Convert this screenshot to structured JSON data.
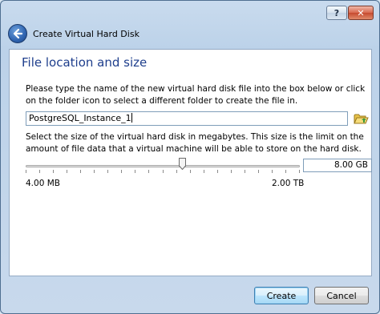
{
  "window": {
    "header_title": "Create Virtual Hard Disk"
  },
  "titlebar": {
    "help_label": "?",
    "close_label": "✕"
  },
  "page": {
    "title": "File location and size",
    "location_instruction": "Please type the name of the new virtual hard disk file into the box below or click on the folder icon to select a different folder to create the file in.",
    "file_name_value": "PostgreSQL_Instance_1",
    "size_instruction": "Select the size of the virtual hard disk in megabytes. This size is the limit on the amount of file data that a virtual machine will be able to store on the hard disk.",
    "size_value": "8.00 GB",
    "slider_min_label": "4.00 MB",
    "slider_max_label": "2.00 TB",
    "slider_position_fraction": 0.57
  },
  "buttons": {
    "create_label": "Create",
    "cancel_label": "Cancel"
  },
  "icons": {
    "back": "back-arrow-icon",
    "folder": "folder-browse-icon"
  },
  "colors": {
    "title_text": "#1e3e8c",
    "window_frame": "#bcd2e9",
    "close_button": "#c64a2f"
  }
}
